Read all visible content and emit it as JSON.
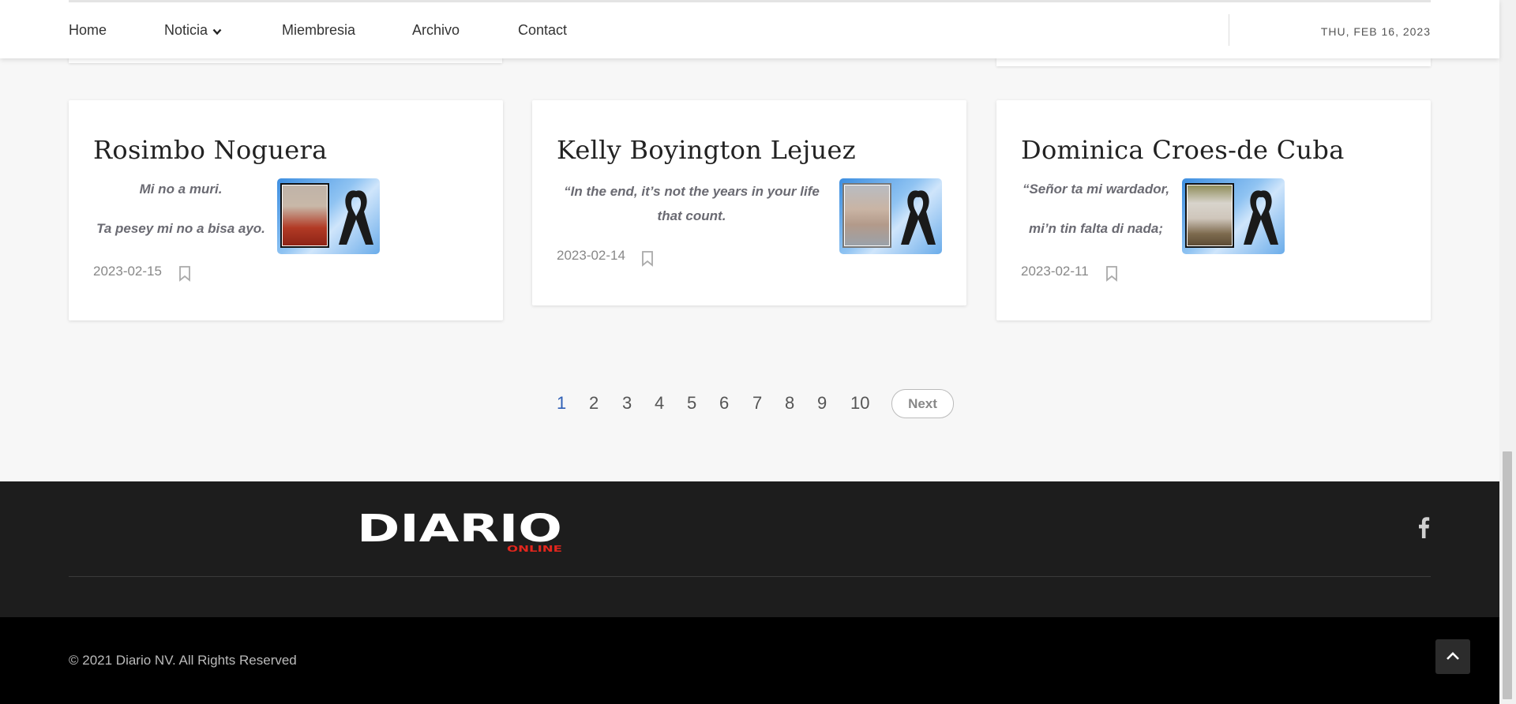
{
  "nav": {
    "items": [
      "Home",
      "Noticia",
      "Miembresia",
      "Archivo",
      "Contact"
    ],
    "date": "THU, FEB 16, 2023"
  },
  "cards": [
    {
      "name": "Rosimbo Noguera",
      "quote": [
        "Mi no a muri.",
        "Ta pesey mi no a bisa ayo."
      ],
      "date": "2023-02-15"
    },
    {
      "name": "Kelly Boyington Lejuez",
      "quote": [
        "“In the end, it’s not the years in your life",
        "that count."
      ],
      "date": "2023-02-14"
    },
    {
      "name": "Dominica Croes-de Cuba",
      "quote": [
        "“Señor ta mi wardador,",
        "mi’n tin falta di nada;"
      ],
      "date": "2023-02-11"
    }
  ],
  "pagination": {
    "pages": [
      "1",
      "2",
      "3",
      "4",
      "5",
      "6",
      "7",
      "8",
      "9",
      "10"
    ],
    "active": "1",
    "next_label": "Next"
  },
  "footer": {
    "logo_main": "DIARIO",
    "logo_sub": "ONLINE",
    "copyright": "© 2021 Diario NV. All Rights Reserved"
  },
  "colors": {
    "accent": "#2f5fb5",
    "footer_top": "#1d1d1d",
    "footer_bottom": "#000000",
    "logo_red": "#e3261d"
  },
  "icons": [
    "chevron-down-icon",
    "bookmark-icon",
    "facebook-icon",
    "chevron-up-icon",
    "black-ribbon-icon"
  ]
}
